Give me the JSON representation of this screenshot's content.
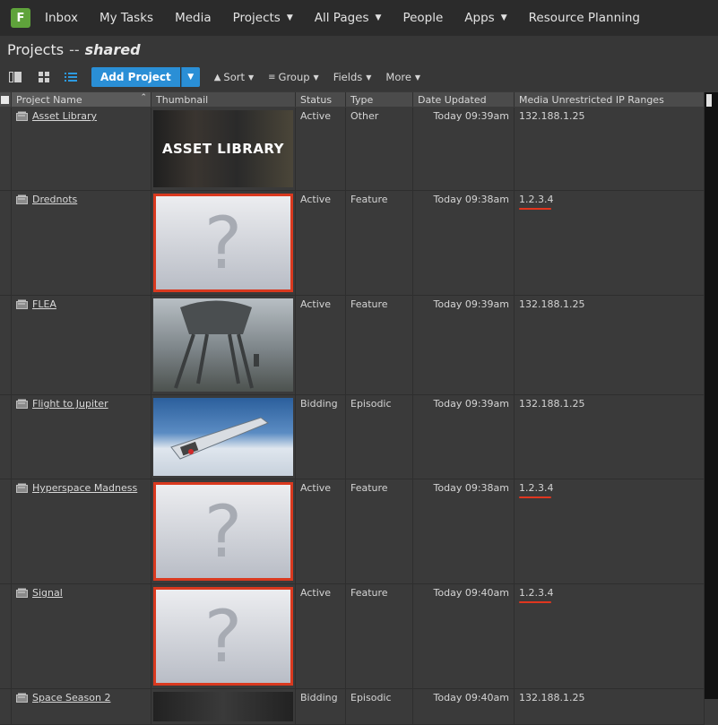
{
  "nav": {
    "logo": "F",
    "items": [
      {
        "label": "Inbox",
        "dropdown": false
      },
      {
        "label": "My Tasks",
        "dropdown": false
      },
      {
        "label": "Media",
        "dropdown": false
      },
      {
        "label": "Projects",
        "dropdown": true
      },
      {
        "label": "All Pages",
        "dropdown": true
      },
      {
        "label": "People",
        "dropdown": false
      },
      {
        "label": "Apps",
        "dropdown": true
      },
      {
        "label": "Resource Planning",
        "dropdown": false
      }
    ]
  },
  "page": {
    "title": "Projects",
    "separator": "--",
    "subtitle": "shared"
  },
  "toolbar": {
    "add_label": "Add Project",
    "sort_label": "Sort",
    "group_label": "Group",
    "fields_label": "Fields",
    "more_label": "More"
  },
  "table": {
    "columns": [
      "Project Name",
      "Thumbnail",
      "Status",
      "Type",
      "Date Updated",
      "Media Unrestricted IP Ranges"
    ],
    "rows": [
      {
        "name": "Asset Library",
        "thumb": "ASSET LIBRARY",
        "status": "Active",
        "type": "Other",
        "date": "Today 09:39am",
        "ip": "132.188.1.25",
        "placeholder": false,
        "flag": false
      },
      {
        "name": "Drednots",
        "thumb": "?",
        "status": "Active",
        "type": "Feature",
        "date": "Today 09:38am",
        "ip": "1.2.3.4",
        "placeholder": true,
        "flag": true
      },
      {
        "name": "FLEA",
        "thumb": "",
        "status": "Active",
        "type": "Feature",
        "date": "Today 09:39am",
        "ip": "132.188.1.25",
        "placeholder": false,
        "flag": false
      },
      {
        "name": "Flight to Jupiter",
        "thumb": "",
        "status": "Bidding",
        "type": "Episodic",
        "date": "Today 09:39am",
        "ip": "132.188.1.25",
        "placeholder": false,
        "flag": false
      },
      {
        "name": "Hyperspace Madness",
        "thumb": "?",
        "status": "Active",
        "type": "Feature",
        "date": "Today 09:38am",
        "ip": "1.2.3.4",
        "placeholder": true,
        "flag": true
      },
      {
        "name": "Signal",
        "thumb": "?",
        "status": "Active",
        "type": "Feature",
        "date": "Today 09:40am",
        "ip": "1.2.3.4",
        "placeholder": true,
        "flag": true
      },
      {
        "name": "Space Season 2",
        "thumb": "",
        "status": "Bidding",
        "type": "Episodic",
        "date": "Today 09:40am",
        "ip": "132.188.1.25",
        "placeholder": false,
        "flag": false
      }
    ]
  },
  "colors": {
    "accent": "#2a8fd6",
    "highlight_red": "#d9391f",
    "logo_green": "#5fa33b"
  }
}
